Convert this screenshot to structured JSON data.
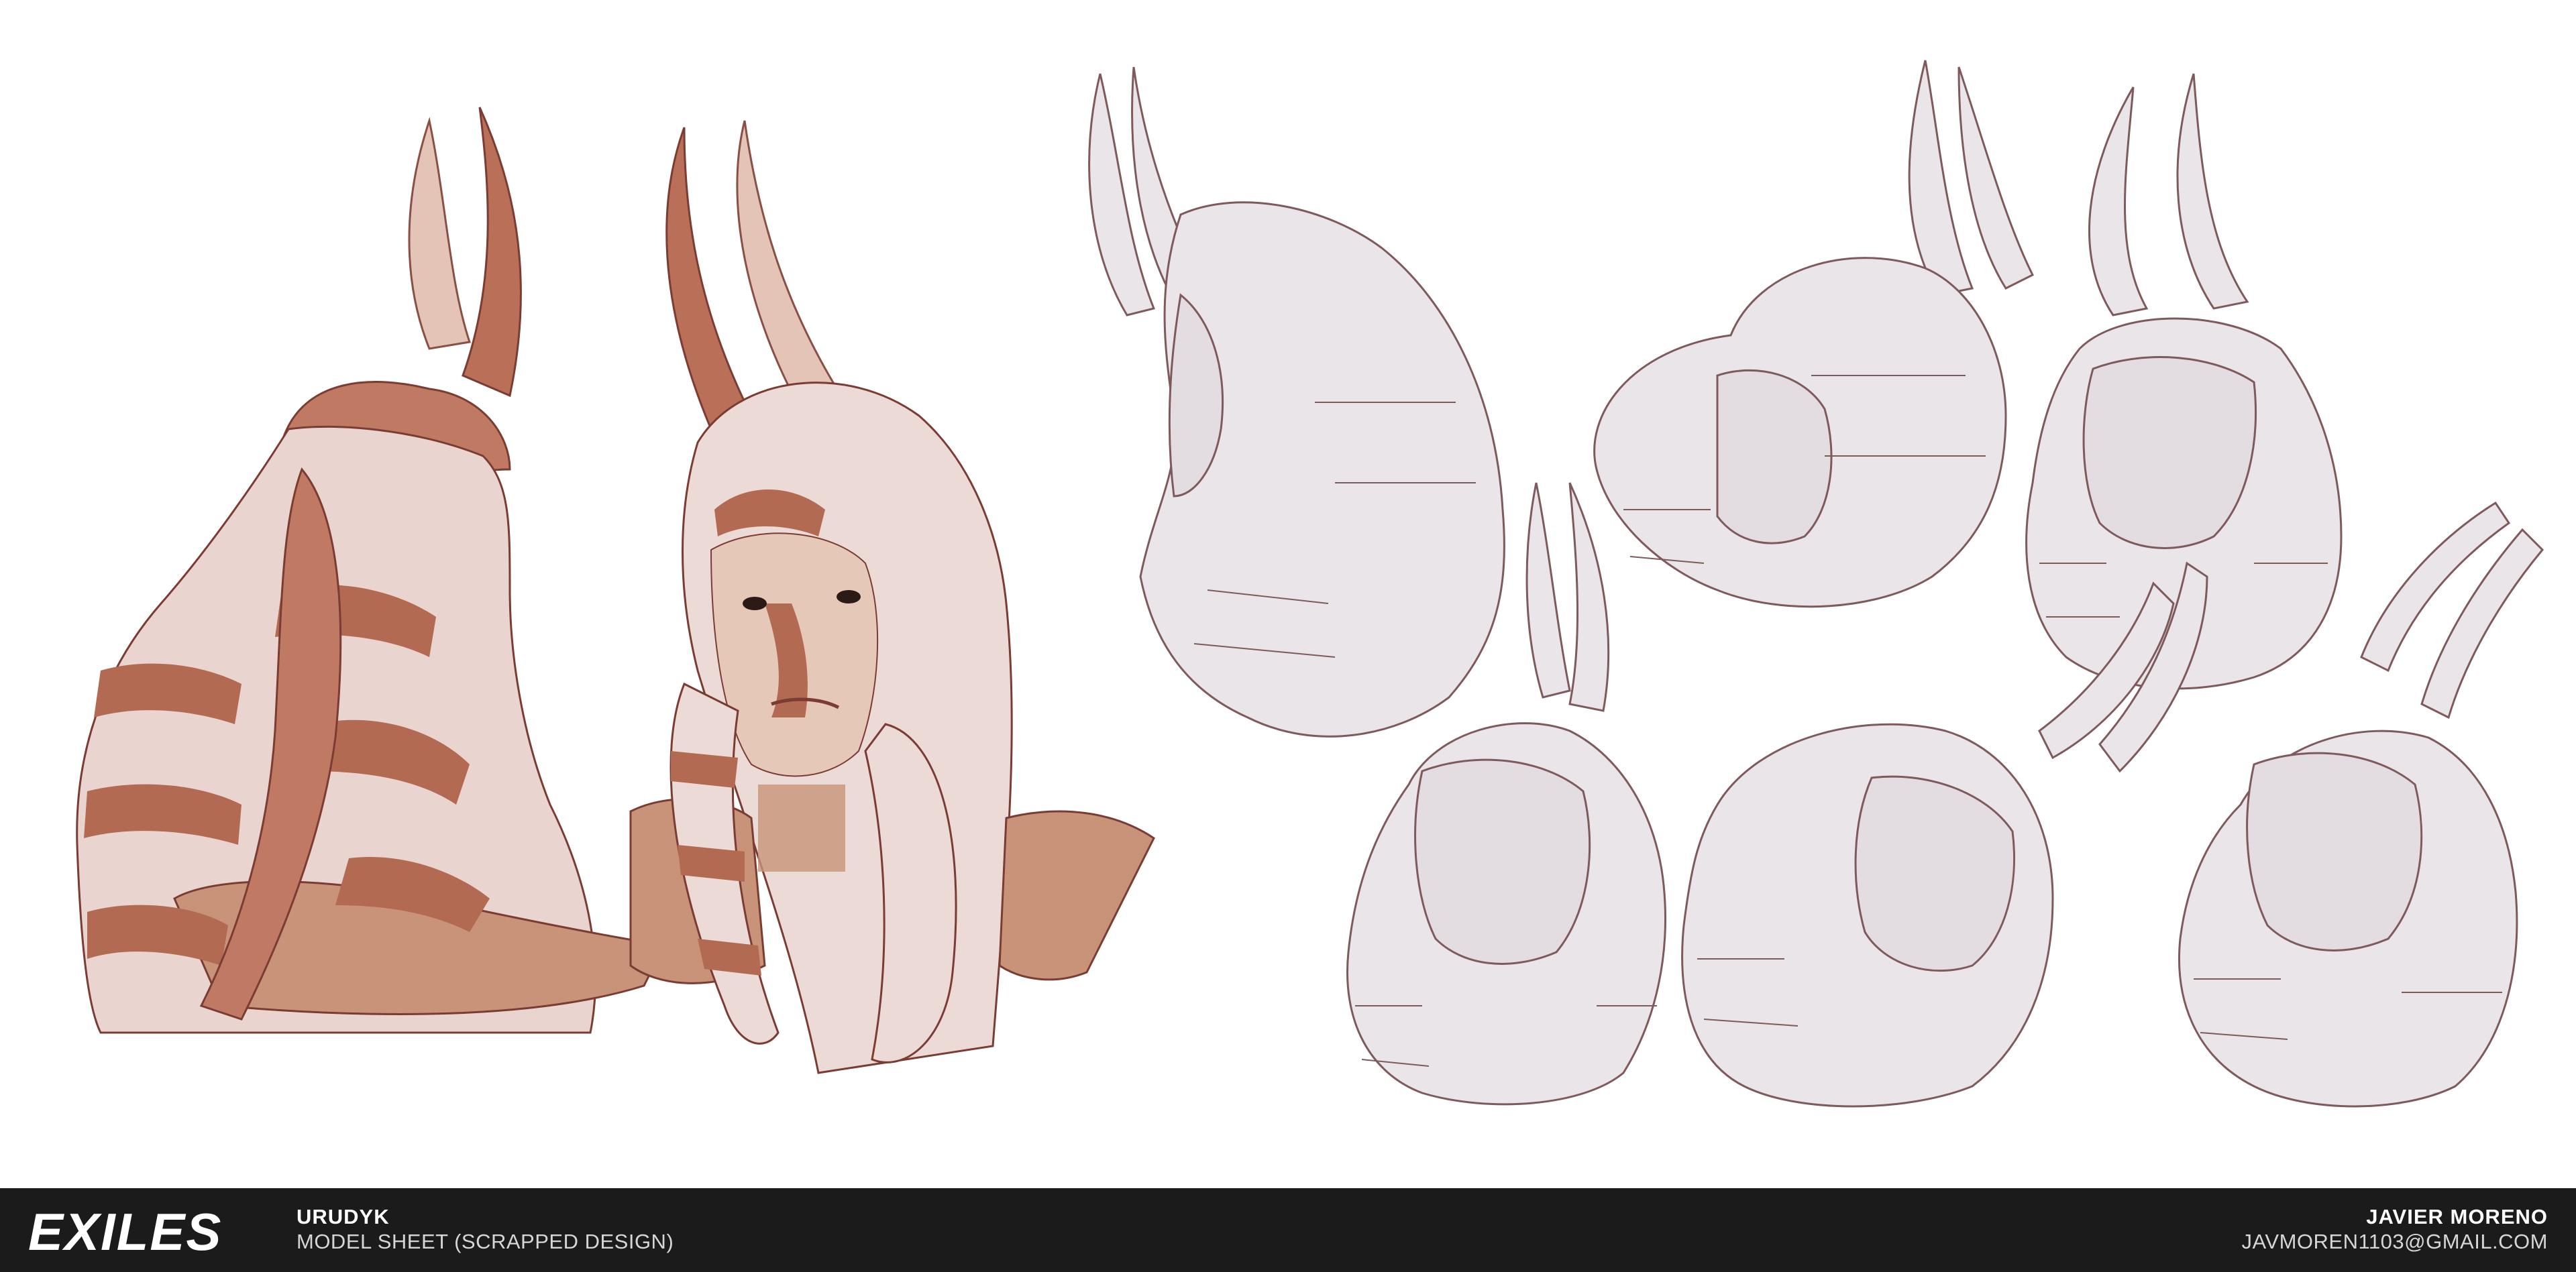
{
  "artwork": {
    "colored_views": [
      "back-view",
      "front-view"
    ],
    "sketch_views": [
      "profile-left",
      "three-quarter-right",
      "front-up",
      "looking-up",
      "profile-right-down",
      "tilted-up"
    ]
  },
  "footer": {
    "logo_text": "EXILES",
    "character_name": "URUDYK",
    "sheet_label": "MODEL SHEET (SCRAPPED DESIGN)",
    "artist_name": "JAVIER MORENO",
    "artist_email": "JAVMOREN1103@GMAIL.COM"
  },
  "colors": {
    "background": "#ffffff",
    "footer_bar": "#1b1b1b",
    "skin_light": "#ecdad6",
    "skin_stripe": "#b36a52",
    "horn": "#c98a73",
    "sketch_fill": "#e9e5e8",
    "sketch_line": "#7f5a5c"
  }
}
